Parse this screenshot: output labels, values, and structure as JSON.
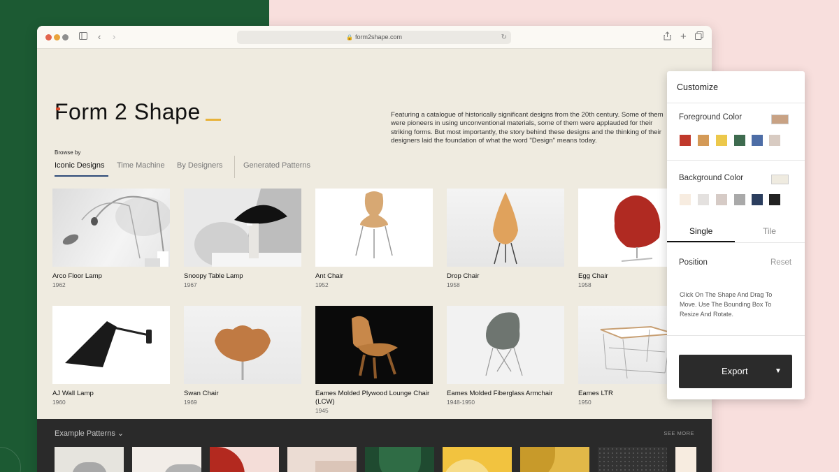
{
  "browser": {
    "url": "form2shape.com",
    "traffic_colors": [
      "#e2654e",
      "#e9a33b",
      "#8e8e8e"
    ]
  },
  "site": {
    "logo": "Form 2 Shape",
    "description": "Featuring a catalogue of historically significant designs from the 20th century. Some of them were pioneers in using unconventional materials, some of them were applauded for their striking forms. But most importantly, the story behind these designs and the thinking of their designers laid the foundation of what the word \"Design\" means today.",
    "browse_label": "Browse by",
    "tabs": [
      "Iconic Designs",
      "Time Machine",
      "By Designers",
      "Generated Patterns"
    ]
  },
  "products": [
    {
      "name": "Arco Floor Lamp",
      "year": "1962"
    },
    {
      "name": "Snoopy Table Lamp",
      "year": "1967"
    },
    {
      "name": "Ant Chair",
      "year": "1952"
    },
    {
      "name": "Drop Chair",
      "year": "1958"
    },
    {
      "name": "Egg Chair",
      "year": "1958"
    },
    {
      "name": "AJ Wall Lamp",
      "year": "1960"
    },
    {
      "name": "Swan Chair",
      "year": "1969"
    },
    {
      "name": "Eames Molded Plywood Lounge Chair (LCW)",
      "year": "1945"
    },
    {
      "name": "Eames Molded Fiberglass Armchair",
      "year": "1948-1950"
    },
    {
      "name": "Eames LTR",
      "year": "1950"
    }
  ],
  "patterns": {
    "title": "Example Patterns",
    "see_more": "SEE MORE"
  },
  "customize": {
    "title": "Customize",
    "foreground_label": "Foreground Color",
    "foreground_selected": "#c8a284",
    "foreground_colors": [
      "#c0392b",
      "#d49a57",
      "#ecc84b",
      "#3e6b4f",
      "#4d6da6",
      "#d8cbc2"
    ],
    "background_label": "Background Color",
    "background_selected": "#efebe0",
    "background_colors": [
      "#f7ece0",
      "#e4e1df",
      "#d6cbc6",
      "#a9a9a9",
      "#2b3e5e",
      "#222222"
    ],
    "modes": [
      "Single",
      "Tile"
    ],
    "position_label": "Position",
    "reset_label": "Reset",
    "help_text": "Click On The Shape And Drag To Move. Use The Bounding Box To Resize And Rotate.",
    "export_label": "Export"
  }
}
